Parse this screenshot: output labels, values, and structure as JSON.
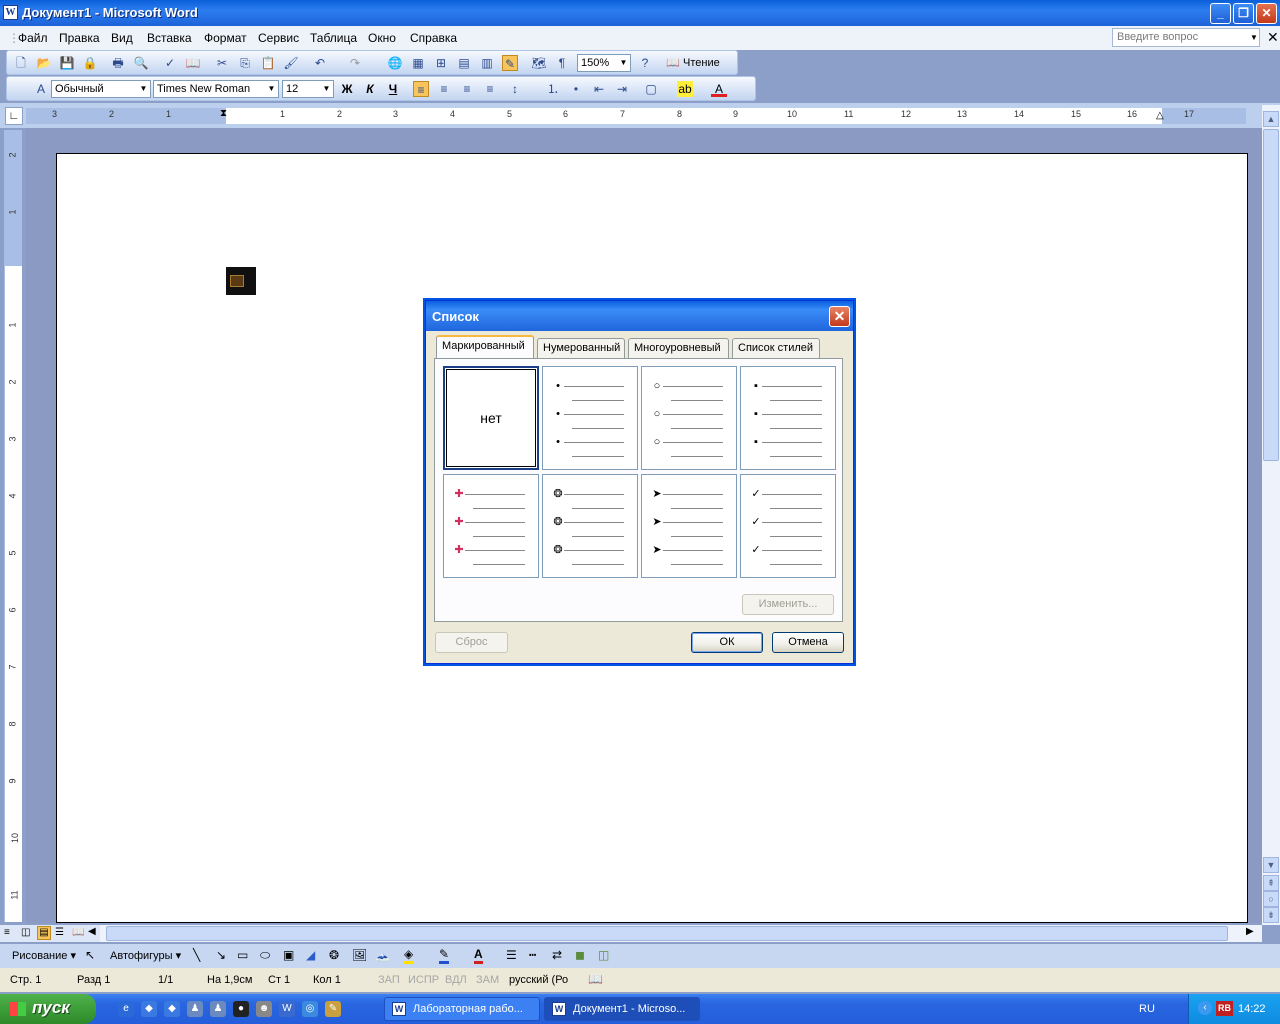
{
  "window": {
    "title": "Документ1 - Microsoft Word",
    "icon": "W"
  },
  "menu": {
    "items": [
      "Файл",
      "Правка",
      "Вид",
      "Вставка",
      "Формат",
      "Сервис",
      "Таблица",
      "Окно",
      "Справка"
    ],
    "help_placeholder": "Введите вопрос"
  },
  "toolbar": {
    "zoom": "150%",
    "reading_label": "Чтение"
  },
  "format": {
    "style": "Обычный",
    "font": "Times New Roman",
    "size": "12",
    "bold": "Ж",
    "italic": "К",
    "underline": "Ч"
  },
  "ruler": {
    "h_numbers": [
      "3",
      "2",
      "1",
      "1",
      "2",
      "3",
      "4",
      "5",
      "6",
      "7",
      "8",
      "9",
      "10",
      "11",
      "12",
      "13",
      "14",
      "15",
      "16",
      "17"
    ],
    "v_numbers": [
      "2",
      "1",
      "1",
      "2",
      "3",
      "4",
      "5",
      "6",
      "7",
      "8",
      "9",
      "10",
      "11"
    ]
  },
  "dialog": {
    "title": "Список",
    "tabs": [
      "Маркированный",
      "Нумерованный",
      "Многоуровневый",
      "Список стилей"
    ],
    "none_label": "нет",
    "bullets": [
      "none",
      "•",
      "○",
      "▪",
      "✚",
      "❂",
      "➤",
      "✓"
    ],
    "modify_button": "Изменить...",
    "reset_button": "Сброс",
    "ok_button": "ОК",
    "cancel_button": "Отмена"
  },
  "drawbar": {
    "drawing": "Рисование",
    "autoshapes": "Автофигуры"
  },
  "status": {
    "page": "Стр. 1",
    "section": "Разд 1",
    "pages": "1/1",
    "at": "На 1,9см",
    "line": "Ст 1",
    "col": "Кол 1",
    "rec": "ЗАП",
    "trk": "ИСПР",
    "ext": "ВДЛ",
    "ovr": "ЗАМ",
    "lang": "русский (Ро"
  },
  "taskbar": {
    "start": "пуск",
    "tasks": [
      "Лабораторная рабо...",
      "Документ1 - Microso..."
    ],
    "lang": "RU",
    "clock": "14:22"
  }
}
